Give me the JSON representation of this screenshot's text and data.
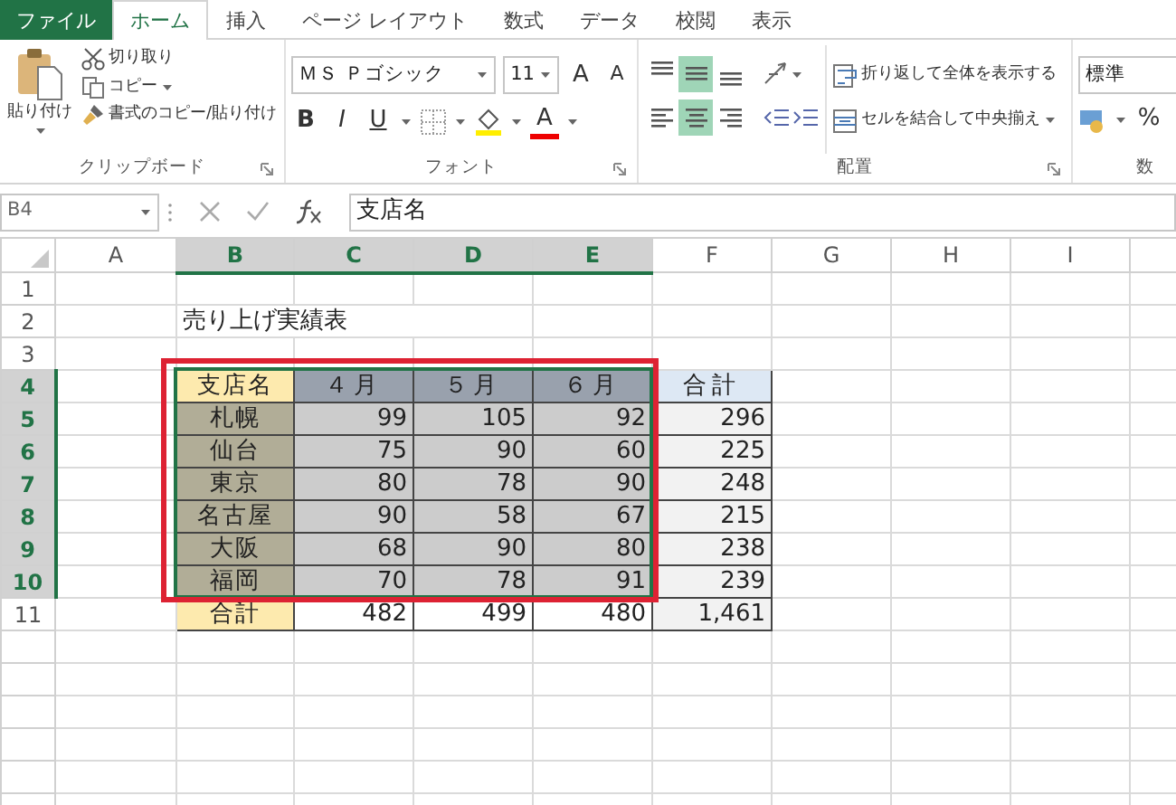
{
  "ribbon_tabs": [
    {
      "label": "ファイル",
      "kind": "file",
      "selected": false
    },
    {
      "label": "ホーム",
      "kind": "tab",
      "selected": true
    },
    {
      "label": "挿入",
      "kind": "tab",
      "selected": false
    },
    {
      "label": "ページ レイアウト",
      "kind": "tab",
      "selected": false
    },
    {
      "label": "数式",
      "kind": "tab",
      "selected": false
    },
    {
      "label": "データ",
      "kind": "tab",
      "selected": false
    },
    {
      "label": "校閲",
      "kind": "tab",
      "selected": false
    },
    {
      "label": "表示",
      "kind": "tab",
      "selected": false
    }
  ],
  "clipboard": {
    "paste": "貼り付け",
    "cut": "切り取り",
    "copy": "コピー",
    "format_painter": "書式のコピー/貼り付け",
    "group_label": "クリップボード"
  },
  "font": {
    "name": "ＭＳ Ｐゴシック",
    "size": "11",
    "grow": "A",
    "shrink": "A",
    "bold": "B",
    "italic": "I",
    "underline": "U",
    "font_color": "A",
    "group_label": "フォント"
  },
  "alignment": {
    "vertical": [
      {
        "selected": false
      },
      {
        "selected": true
      },
      {
        "selected": false
      }
    ],
    "horizontal": [
      {
        "selected": false
      },
      {
        "selected": true
      },
      {
        "selected": false
      }
    ],
    "wrap_text": "折り返して全体を表示する",
    "merge_center": "セルを結合して中央揃え",
    "group_label": "配置"
  },
  "number": {
    "format": "標準",
    "percent": "%",
    "group_label": "数"
  },
  "formula_bar": {
    "name_box": "B4",
    "value": "支店名"
  },
  "columns": [
    {
      "label": "A",
      "selected": false
    },
    {
      "label": "B",
      "selected": true
    },
    {
      "label": "C",
      "selected": true
    },
    {
      "label": "D",
      "selected": true
    },
    {
      "label": "E",
      "selected": true
    },
    {
      "label": "F",
      "selected": false
    },
    {
      "label": "G",
      "selected": false
    },
    {
      "label": "H",
      "selected": false
    },
    {
      "label": "I",
      "selected": false
    }
  ],
  "rows": [
    {
      "number": "1",
      "selected": false
    },
    {
      "number": "2",
      "selected": false
    },
    {
      "number": "3",
      "selected": false
    },
    {
      "number": "4",
      "selected": true
    },
    {
      "number": "5",
      "selected": true
    },
    {
      "number": "6",
      "selected": true
    },
    {
      "number": "7",
      "selected": true
    },
    {
      "number": "8",
      "selected": true
    },
    {
      "number": "9",
      "selected": true
    },
    {
      "number": "10",
      "selected": true
    },
    {
      "number": "11",
      "selected": false
    }
  ],
  "sheet_title": "売り上げ実績表",
  "table": [
    [
      {
        "text": "支店名",
        "kind": "head-branch",
        "selected": false,
        "active": true
      },
      {
        "text": "４月",
        "kind": "head-month",
        "selected": true
      },
      {
        "text": "５月",
        "kind": "head-month",
        "selected": true
      },
      {
        "text": "６月",
        "kind": "head-month",
        "selected": true
      },
      {
        "text": "合計",
        "kind": "head-total",
        "selected": false
      }
    ],
    [
      {
        "text": "札幌",
        "kind": "branch",
        "selected": true
      },
      {
        "text": "99",
        "kind": "value",
        "selected": true
      },
      {
        "text": "105",
        "kind": "value",
        "selected": true
      },
      {
        "text": "92",
        "kind": "value",
        "selected": true
      },
      {
        "text": "296",
        "kind": "total",
        "selected": false
      }
    ],
    [
      {
        "text": "仙台",
        "kind": "branch",
        "selected": true
      },
      {
        "text": "75",
        "kind": "value",
        "selected": true
      },
      {
        "text": "90",
        "kind": "value",
        "selected": true
      },
      {
        "text": "60",
        "kind": "value",
        "selected": true
      },
      {
        "text": "225",
        "kind": "total",
        "selected": false
      }
    ],
    [
      {
        "text": "東京",
        "kind": "branch",
        "selected": true
      },
      {
        "text": "80",
        "kind": "value",
        "selected": true
      },
      {
        "text": "78",
        "kind": "value",
        "selected": true
      },
      {
        "text": "90",
        "kind": "value",
        "selected": true
      },
      {
        "text": "248",
        "kind": "total",
        "selected": false
      }
    ],
    [
      {
        "text": "名古屋",
        "kind": "branch",
        "selected": true
      },
      {
        "text": "90",
        "kind": "value",
        "selected": true
      },
      {
        "text": "58",
        "kind": "value",
        "selected": true
      },
      {
        "text": "67",
        "kind": "value",
        "selected": true
      },
      {
        "text": "215",
        "kind": "total",
        "selected": false
      }
    ],
    [
      {
        "text": "大阪",
        "kind": "branch",
        "selected": true
      },
      {
        "text": "68",
        "kind": "value",
        "selected": true
      },
      {
        "text": "90",
        "kind": "value",
        "selected": true
      },
      {
        "text": "80",
        "kind": "value",
        "selected": true
      },
      {
        "text": "238",
        "kind": "total",
        "selected": false
      }
    ],
    [
      {
        "text": "福岡",
        "kind": "branch",
        "selected": true
      },
      {
        "text": "70",
        "kind": "value",
        "selected": true
      },
      {
        "text": "78",
        "kind": "value",
        "selected": true
      },
      {
        "text": "91",
        "kind": "value",
        "selected": true
      },
      {
        "text": "239",
        "kind": "total",
        "selected": false
      }
    ],
    [
      {
        "text": "合計",
        "kind": "head-branch",
        "selected": false
      },
      {
        "text": "482",
        "kind": "sum",
        "selected": false
      },
      {
        "text": "499",
        "kind": "sum",
        "selected": false
      },
      {
        "text": "480",
        "kind": "sum",
        "selected": false
      },
      {
        "text": "1,461",
        "kind": "total",
        "selected": false
      }
    ]
  ]
}
